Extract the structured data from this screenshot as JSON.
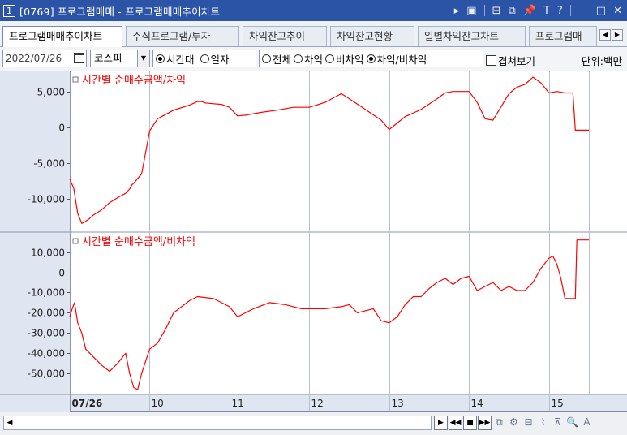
{
  "window": {
    "number": "1",
    "title": "[0769] 프로그램매매 - 프로그램매매추이차트",
    "controls": [
      "▸",
      "▣",
      "⊟",
      "⧉",
      "📌",
      "T",
      "?",
      "—",
      "□",
      "✕"
    ]
  },
  "tabs": [
    {
      "label": "프로그램매매추이차트",
      "active": true
    },
    {
      "label": "주식프로그램/투자",
      "active": false
    },
    {
      "label": "차익잔고추이",
      "active": false
    },
    {
      "label": "차익잔고현황",
      "active": false
    },
    {
      "label": "일별차익잔고차트",
      "active": false
    },
    {
      "label": "프로그램매",
      "active": false
    }
  ],
  "options": {
    "date": "2022/07/26",
    "market": "코스피",
    "period_radios": [
      {
        "label": "시간대",
        "selected": true
      },
      {
        "label": "일자",
        "selected": false
      }
    ],
    "type_radios": [
      {
        "label": "전체",
        "selected": false
      },
      {
        "label": "차익",
        "selected": false
      },
      {
        "label": "비차익",
        "selected": false
      },
      {
        "label": "차익/비차익",
        "selected": true
      }
    ],
    "overlay_label": "겹쳐보기",
    "overlay_checked": false,
    "unit": "단위:백만"
  },
  "chart_data": [
    {
      "type": "line",
      "title": "시간별 순매수금액/차익",
      "color": "#ff0000",
      "yticks": [
        5000,
        0,
        -5000,
        -10000
      ],
      "ytick_labels": [
        "5,000",
        "0",
        "-5,000",
        "-10,000"
      ],
      "ylim": [
        -14500,
        7800
      ],
      "x": [
        9.0,
        9.05,
        9.1,
        9.15,
        9.2,
        9.25,
        9.3,
        9.4,
        9.5,
        9.6,
        9.7,
        9.75,
        9.78,
        9.8,
        9.9,
        10.0,
        10.1,
        10.3,
        10.5,
        10.6,
        10.65,
        10.7,
        10.8,
        10.9,
        11.0,
        11.1,
        11.2,
        11.4,
        11.6,
        11.8,
        12.0,
        12.2,
        12.4,
        12.5,
        12.7,
        12.9,
        13.0,
        13.1,
        13.2,
        13.4,
        13.6,
        13.7,
        13.8,
        14.0,
        14.1,
        14.2,
        14.3,
        14.5,
        14.6,
        14.7,
        14.8,
        14.9,
        15.0,
        15.1,
        15.2,
        15.3,
        15.33,
        15.35,
        15.5
      ],
      "y": [
        -7200,
        -8500,
        -12000,
        -13400,
        -13100,
        -12700,
        -12200,
        -11500,
        -10500,
        -9800,
        -9200,
        -8600,
        -8000,
        -7800,
        -6500,
        -500,
        1200,
        2400,
        3100,
        3600,
        3600,
        3400,
        3300,
        3200,
        2800,
        1600,
        1700,
        2100,
        2400,
        2800,
        2800,
        3500,
        4700,
        4000,
        2500,
        1000,
        -300,
        600,
        1500,
        2500,
        4000,
        4800,
        5000,
        5000,
        3500,
        1200,
        1000,
        4700,
        5600,
        6000,
        7000,
        6200,
        4800,
        5000,
        4800,
        4800,
        -400,
        -400,
        -400
      ]
    },
    {
      "type": "line",
      "title": "시간별 순매수금액/비차익",
      "color": "#ff0000",
      "yticks": [
        10000,
        0,
        -10000,
        -20000,
        -30000,
        -40000,
        -50000
      ],
      "ytick_labels": [
        "10,000",
        "0",
        "-10,000",
        "-20,000",
        "-30,000",
        "-40,000",
        "-50,000"
      ],
      "ylim": [
        -60000,
        19500
      ],
      "x": [
        9.0,
        9.03,
        9.06,
        9.1,
        9.15,
        9.2,
        9.3,
        9.4,
        9.5,
        9.6,
        9.7,
        9.75,
        9.8,
        9.85,
        9.9,
        10.0,
        10.1,
        10.2,
        10.3,
        10.5,
        10.6,
        10.8,
        11.0,
        11.1,
        11.3,
        11.5,
        11.7,
        11.9,
        12.0,
        12.2,
        12.4,
        12.5,
        12.6,
        12.8,
        12.9,
        13.0,
        13.1,
        13.2,
        13.3,
        13.4,
        13.5,
        13.6,
        13.7,
        13.8,
        13.9,
        14.0,
        14.1,
        14.2,
        14.3,
        14.4,
        14.5,
        14.6,
        14.7,
        14.8,
        14.9,
        15.0,
        15.05,
        15.1,
        15.15,
        15.2,
        15.28,
        15.33,
        15.35,
        15.5
      ],
      "y": [
        -22000,
        -18000,
        -15000,
        -25000,
        -30000,
        -38000,
        -42000,
        -46000,
        -49000,
        -45000,
        -40000,
        -50000,
        -57000,
        -58000,
        -50000,
        -38000,
        -35000,
        -28000,
        -20000,
        -14000,
        -12000,
        -13000,
        -17000,
        -22000,
        -18000,
        -15000,
        -16000,
        -18000,
        -18000,
        -18000,
        -17000,
        -16000,
        -20000,
        -18000,
        -24000,
        -25000,
        -22000,
        -16000,
        -12000,
        -12000,
        -8000,
        -5000,
        -3000,
        -6000,
        -3000,
        -2000,
        -9000,
        -7000,
        -5000,
        -9000,
        -7000,
        -9000,
        -9000,
        -5000,
        2000,
        7000,
        8000,
        4000,
        -3000,
        -13000,
        -13000,
        -13000,
        16000,
        16000
      ]
    }
  ],
  "x_axis": {
    "ticks": [
      {
        "label": "07/26",
        "value": 9.0,
        "bold": true
      },
      {
        "label": "10",
        "value": 10.0
      },
      {
        "label": "11",
        "value": 11.0
      },
      {
        "label": "12",
        "value": 12.0
      },
      {
        "label": "13",
        "value": 13.0
      },
      {
        "label": "14",
        "value": 14.0
      },
      {
        "label": "15",
        "value": 15.0
      }
    ]
  },
  "toolbar": {
    "buttons": [
      {
        "name": "play-icon",
        "glyph": "▶"
      },
      {
        "name": "rewind-icon",
        "glyph": "◀◀"
      },
      {
        "name": "stop-icon",
        "glyph": "■"
      },
      {
        "name": "fast-forward-icon",
        "glyph": "▶▶"
      },
      {
        "name": "window-icon",
        "glyph": "⧉"
      },
      {
        "name": "settings-icon",
        "glyph": "⚙"
      },
      {
        "name": "layout-icon",
        "glyph": "⊟"
      },
      {
        "name": "chart-icon",
        "glyph": "⌇"
      },
      {
        "name": "crosshair-icon",
        "glyph": "⊼"
      },
      {
        "name": "zoom-icon",
        "glyph": "🔍"
      },
      {
        "name": "font-icon",
        "glyph": "A"
      }
    ]
  }
}
